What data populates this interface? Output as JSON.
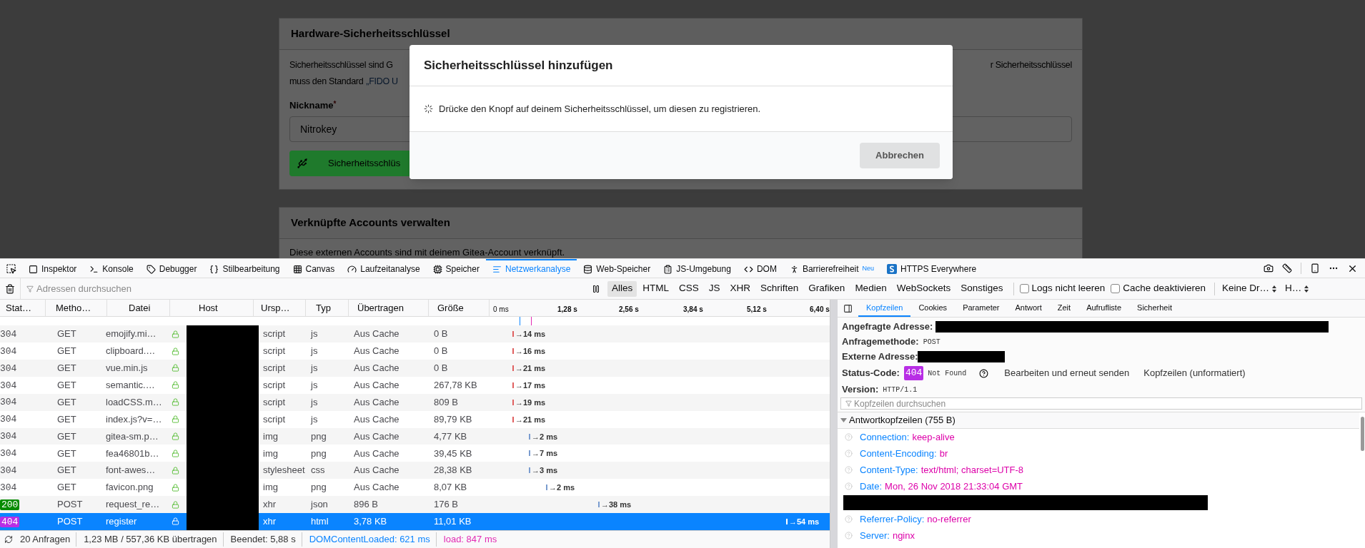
{
  "page": {
    "key_panel": {
      "title": "Hardware-Sicherheitsschlüssel",
      "text_left": "Sicherheitsschlüssel sind G",
      "text_right": "r Sicherheitsschlüssel",
      "text_line2": "muss den Standard",
      "link": "„FIDO U",
      "nickname_label": "Nickname",
      "required_mark": "*",
      "nickname_value": "Nitrokey",
      "register_button": "Sicherheitsschlüs"
    },
    "accounts_panel": {
      "title": "Verknüpfte Accounts verwalten",
      "text": "Diese externen Accounts sind mit deinem Gitea-Account verknüpft."
    }
  },
  "dialog": {
    "title": "Sicherheitsschlüssel hinzufügen",
    "message": "Drücke den Knopf auf deinem Sicherheitsschlüssel, um diesen zu registrieren.",
    "cancel": "Abbrechen"
  },
  "devtools": {
    "tabs": [
      {
        "label": "Inspektor",
        "selected": false
      },
      {
        "label": "Konsole",
        "selected": false
      },
      {
        "label": "Debugger",
        "selected": false
      },
      {
        "label": "Stilbearbeitung",
        "selected": false
      },
      {
        "label": "Canvas",
        "selected": false
      },
      {
        "label": "Laufzeitanalyse",
        "selected": false
      },
      {
        "label": "Speicher",
        "selected": false
      },
      {
        "label": "Netzwerkanalyse",
        "selected": true
      },
      {
        "label": "Web-Speicher",
        "selected": false
      },
      {
        "label": "JS-Umgebung",
        "selected": false
      },
      {
        "label": "DOM",
        "selected": false
      },
      {
        "label": "Barrierefreiheit",
        "selected": false,
        "badge": "Neu"
      },
      {
        "label": "HTTPS Everywhere",
        "selected": false
      }
    ],
    "filter": {
      "placeholder": "Adressen durchsuchen"
    },
    "type_filters": [
      {
        "label": "Alles",
        "selected": true
      },
      {
        "label": "HTML",
        "selected": false
      },
      {
        "label": "CSS",
        "selected": false
      },
      {
        "label": "JS",
        "selected": false
      },
      {
        "label": "XHR",
        "selected": false
      },
      {
        "label": "Schriften",
        "selected": false
      },
      {
        "label": "Grafiken",
        "selected": false
      },
      {
        "label": "Medien",
        "selected": false
      },
      {
        "label": "WebSockets",
        "selected": false
      },
      {
        "label": "Sonstiges",
        "selected": false
      }
    ],
    "checkboxes": [
      {
        "label": "Logs nicht leeren",
        "checked": false
      },
      {
        "label": "Cache deaktivieren",
        "checked": false
      }
    ],
    "dropdowns": [
      "Keine Dr…",
      "H…"
    ],
    "table": {
      "columns": [
        "Stat…",
        "Metho…",
        "Datei",
        "Host",
        "Ursp…",
        "Typ",
        "Übertragen",
        "Größe"
      ],
      "ticks": [
        "0 ms",
        "1,28 s",
        "2,56 s",
        "3,84 s",
        "5,12 s",
        "6,40 s"
      ],
      "rows": [
        {
          "status": "304",
          "method": "GET",
          "file": "emojify.mi…",
          "cause": "script",
          "type": "js",
          "transferred": "Aus Cache",
          "size": "0 B",
          "time": "→14 ms",
          "selected": false
        },
        {
          "status": "304",
          "method": "GET",
          "file": "clipboard.…",
          "cause": "script",
          "type": "js",
          "transferred": "Aus Cache",
          "size": "0 B",
          "time": "→16 ms",
          "selected": false
        },
        {
          "status": "304",
          "method": "GET",
          "file": "vue.min.js",
          "cause": "script",
          "type": "js",
          "transferred": "Aus Cache",
          "size": "0 B",
          "time": "→21 ms",
          "selected": false
        },
        {
          "status": "304",
          "method": "GET",
          "file": "semantic.…",
          "cause": "script",
          "type": "js",
          "transferred": "Aus Cache",
          "size": "267,78 KB",
          "time": "→17 ms",
          "selected": false
        },
        {
          "status": "304",
          "method": "GET",
          "file": "loadCSS.m…",
          "cause": "script",
          "type": "js",
          "transferred": "Aus Cache",
          "size": "809 B",
          "time": "→19 ms",
          "selected": false
        },
        {
          "status": "304",
          "method": "GET",
          "file": "index.js?v=…",
          "cause": "script",
          "type": "js",
          "transferred": "Aus Cache",
          "size": "89,79 KB",
          "time": "→21 ms",
          "selected": false
        },
        {
          "status": "304",
          "method": "GET",
          "file": "gitea-sm.p…",
          "cause": "img",
          "type": "png",
          "transferred": "Aus Cache",
          "size": "4,77 KB",
          "time": "→2 ms",
          "selected": false
        },
        {
          "status": "304",
          "method": "GET",
          "file": "fea46801b…",
          "cause": "img",
          "type": "png",
          "transferred": "Aus Cache",
          "size": "39,45 KB",
          "time": "→7 ms",
          "selected": false
        },
        {
          "status": "304",
          "method": "GET",
          "file": "font-awes…",
          "cause": "stylesheet",
          "type": "css",
          "transferred": "Aus Cache",
          "size": "28,38 KB",
          "time": "→3 ms",
          "selected": false
        },
        {
          "status": "304",
          "method": "GET",
          "file": "favicon.png",
          "cause": "img",
          "type": "png",
          "transferred": "Aus Cache",
          "size": "8,07 KB",
          "time": "→2 ms",
          "selected": false
        },
        {
          "status": "200",
          "color": "#058b00",
          "method": "POST",
          "file": "request_re…",
          "cause": "xhr",
          "type": "json",
          "transferred": "896 B",
          "size": "176 B",
          "time": "→38 ms",
          "selected": false
        },
        {
          "status": "404",
          "color": "#b82ee5",
          "method": "POST",
          "file": "register",
          "cause": "xhr",
          "type": "html",
          "transferred": "3,78 KB",
          "size": "11,01 KB",
          "time": "→54 ms",
          "selected": true
        }
      ]
    },
    "status_bar": {
      "requests": "20 Anfragen",
      "transferred": "1,23 MB / 557,36 KB übertragen",
      "finished": "Beendet: 5,88 s",
      "dom": "DOMContentLoaded: 621 ms",
      "load": "load: 847 ms"
    },
    "details": {
      "tabs": [
        {
          "label": "Kopfzeilen",
          "selected": true
        },
        {
          "label": "Cookies",
          "selected": false
        },
        {
          "label": "Parameter",
          "selected": false
        },
        {
          "label": "Antwort",
          "selected": false
        },
        {
          "label": "Zeit",
          "selected": false
        },
        {
          "label": "Aufrufliste",
          "selected": false
        },
        {
          "label": "Sicherheit",
          "selected": false
        }
      ],
      "requested_address_label": "Angefragte Adresse:",
      "method_label": "Anfragemethode:",
      "method_value": "POST",
      "remote_label": "Externe Adresse:",
      "status_label": "Status-Code:",
      "status_code": "404",
      "status_text": "Not Found",
      "resend": "Bearbeiten und erneut senden",
      "raw_headers": "Kopfzeilen (unformatiert)",
      "version_label": "Version:",
      "version_value": "HTTP/1.1",
      "filter_placeholder": "Kopfzeilen durchsuchen",
      "section": {
        "title": "Antwortkopfzeilen (755 B)",
        "expanded": true
      },
      "headers": [
        {
          "name": "Connection:",
          "value": "keep-alive"
        },
        {
          "name": "Content-Encoding:",
          "value": "br"
        },
        {
          "name": "Content-Type:",
          "value": "text/html; charset=UTF-8"
        },
        {
          "name": "Date:",
          "value": "Mon, 26 Nov 2018 21:33:04 GMT"
        },
        {
          "kind": "redacted"
        },
        {
          "name": "Referrer-Policy:",
          "value": "no-referrer"
        },
        {
          "name": "Server:",
          "value": "nginx"
        }
      ]
    }
  }
}
